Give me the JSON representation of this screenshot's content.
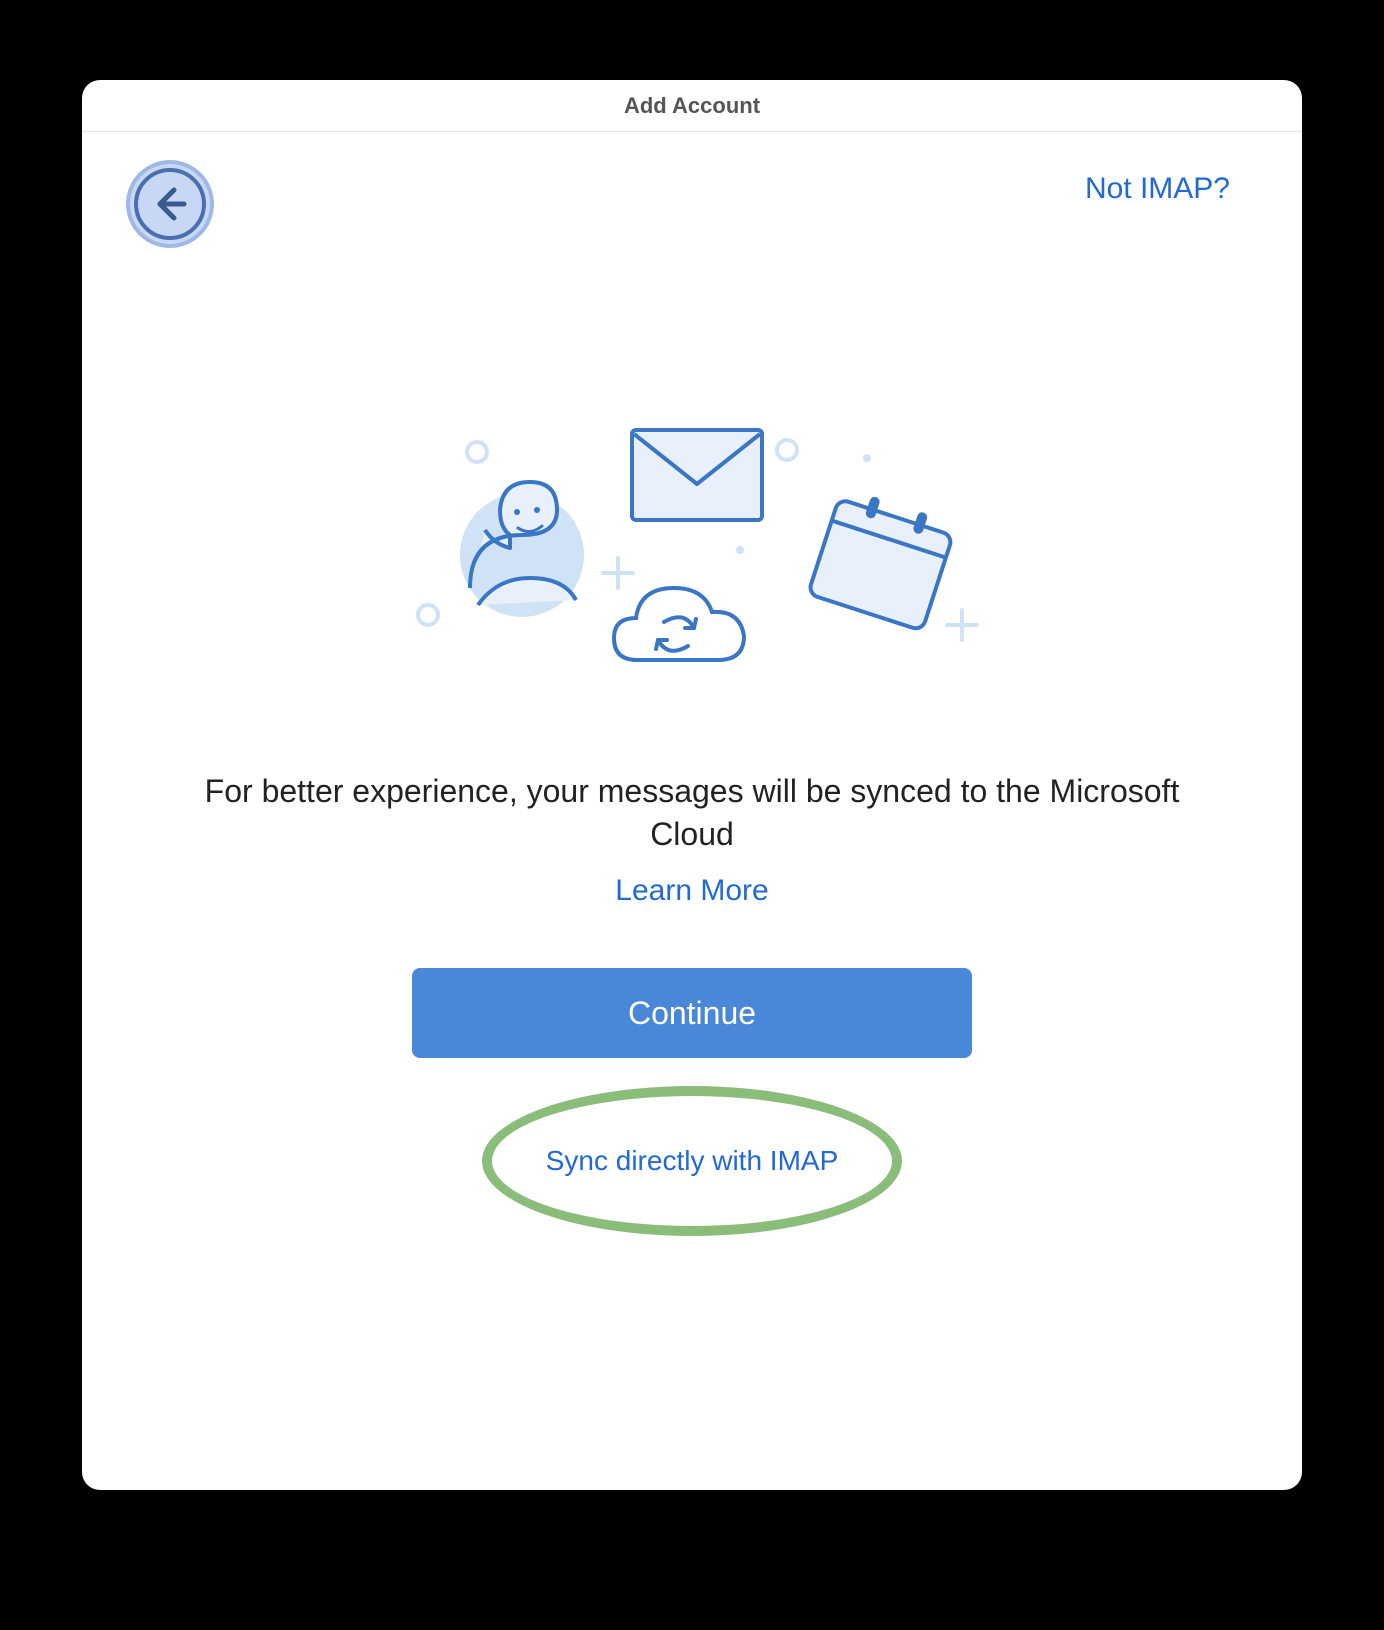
{
  "window": {
    "title": "Add Account"
  },
  "header": {
    "not_imap_label": "Not IMAP?"
  },
  "main": {
    "message": "For better experience, your messages will be synced to the Microsoft Cloud",
    "learn_more_label": "Learn More",
    "continue_label": "Continue",
    "sync_imap_label": "Sync directly with IMAP"
  },
  "colors": {
    "link": "#2169d6",
    "primary_button": "#4987d8",
    "highlight_ring": "#8bbd7a"
  }
}
